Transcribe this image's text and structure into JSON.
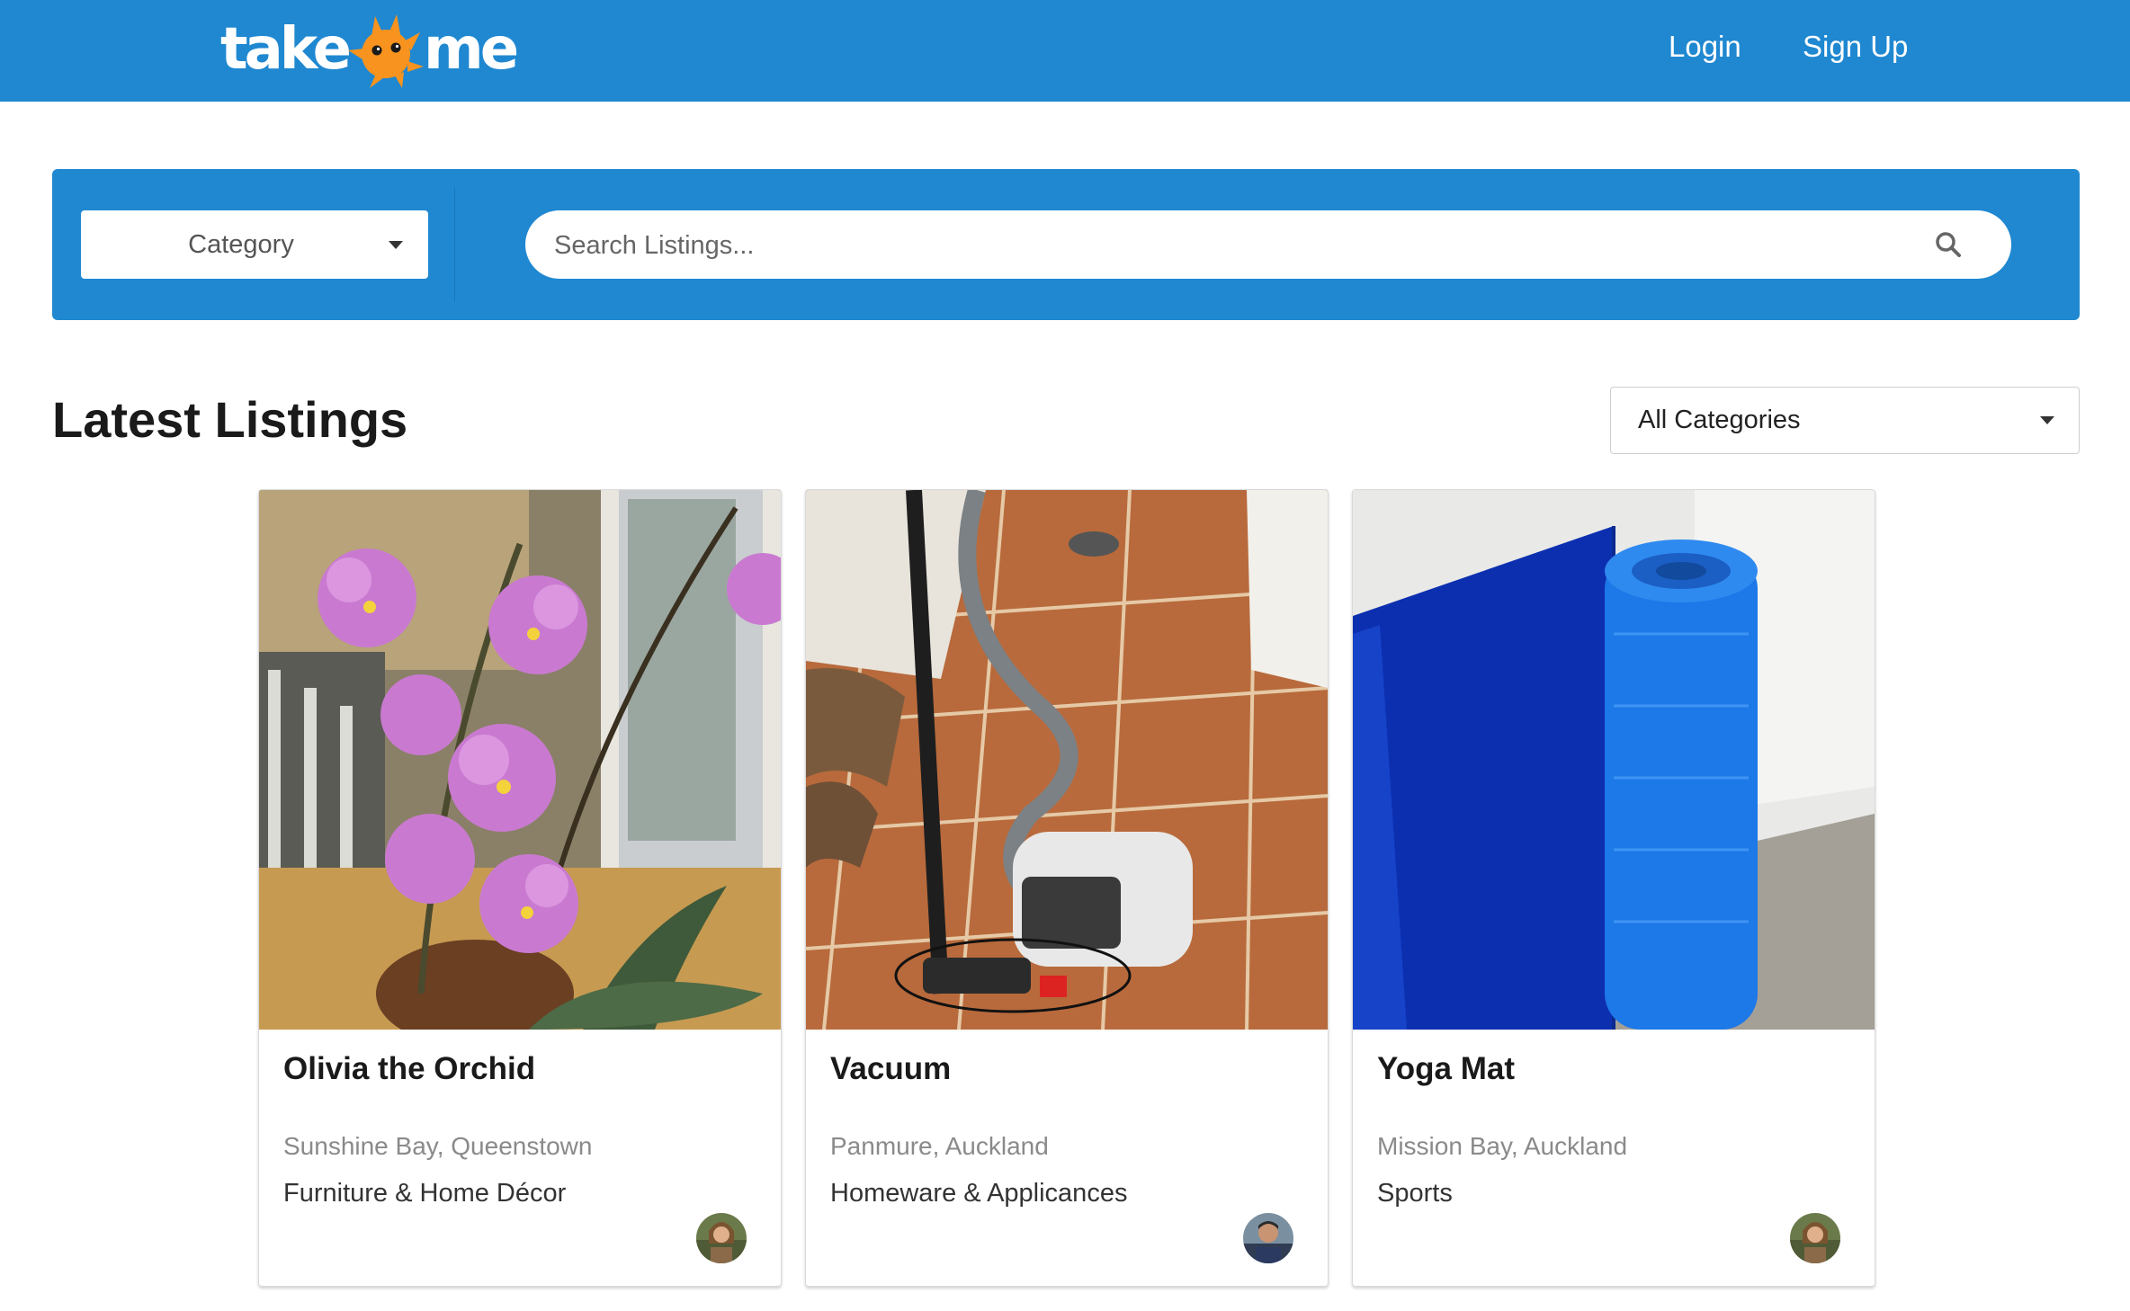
{
  "header": {
    "logo_text_left": "take",
    "logo_text_right": "me",
    "nav": {
      "login": "Login",
      "signup": "Sign Up"
    }
  },
  "search_band": {
    "category_label": "Category",
    "search_placeholder": "Search Listings..."
  },
  "main": {
    "title": "Latest Listings",
    "filter_value": "All Categories"
  },
  "listings": [
    {
      "title": "Olivia the Orchid",
      "location": "Sunshine Bay, Queenstown",
      "category": "Furniture & Home Décor"
    },
    {
      "title": "Vacuum",
      "location": "Panmure, Auckland",
      "category": "Homeware & Applicances"
    },
    {
      "title": "Yoga Mat",
      "location": "Mission Bay, Auckland",
      "category": "Sports"
    }
  ],
  "colors": {
    "brand_blue": "#1f88d1",
    "logo_orange": "#f7931e"
  },
  "icons": [
    "logo-mascot-icon",
    "search-icon",
    "chevron-down-icon",
    "avatar"
  ]
}
